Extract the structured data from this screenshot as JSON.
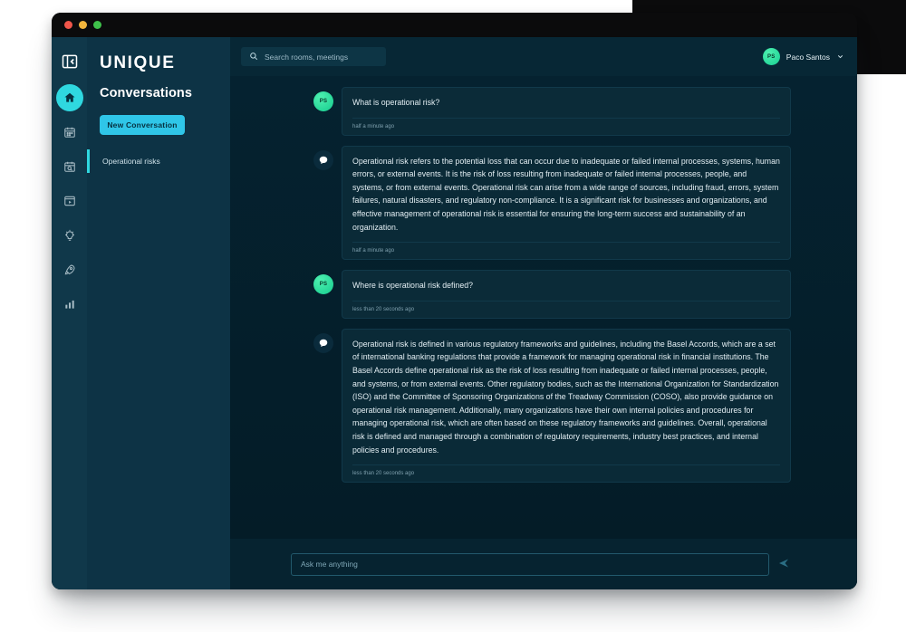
{
  "window": {
    "traffic_lights": [
      "close",
      "minimize",
      "maximize"
    ]
  },
  "rail": {
    "brand_icon": "collapse-panel-icon",
    "items": [
      {
        "name": "home",
        "icon": "home-icon",
        "active": true
      },
      {
        "name": "calendar",
        "icon": "calendar-icon",
        "active": false
      },
      {
        "name": "calendar-search",
        "icon": "calendar-search-icon",
        "active": false
      },
      {
        "name": "recordings",
        "icon": "video-window-icon",
        "active": false
      },
      {
        "name": "insights",
        "icon": "lightbulb-icon",
        "active": false
      },
      {
        "name": "launch",
        "icon": "rocket-icon",
        "active": false
      },
      {
        "name": "analytics",
        "icon": "bar-chart-icon",
        "active": false
      }
    ]
  },
  "brand": {
    "wordmark": "UNIQUE"
  },
  "panel": {
    "title": "Conversations",
    "new_conversation_label": "New Conversation",
    "conversations": [
      {
        "label": "Operational risks",
        "active": true
      }
    ]
  },
  "topbar": {
    "search": {
      "icon": "search-icon",
      "placeholder": "Search rooms, meetings",
      "value": ""
    },
    "user": {
      "initials": "PS",
      "name": "Paco Santos",
      "chevron": "chevron-down-icon"
    }
  },
  "chat": {
    "messages": [
      {
        "role": "user",
        "avatar_initials": "PS",
        "text": "What is operational risk?",
        "timestamp": "half a minute ago"
      },
      {
        "role": "bot",
        "avatar_icon": "assistant-bubble-icon",
        "text": "Operational risk refers to the potential loss that can occur due to inadequate or failed internal processes, systems, human errors, or external events. It is the risk of loss resulting from inadequate or failed internal processes, people, and systems, or from external events. Operational risk can arise from a wide range of sources, including fraud, errors, system failures, natural disasters, and regulatory non-compliance. It is a significant risk for businesses and organizations, and effective management of operational risk is essential for ensuring the long-term success and sustainability of an organization.",
        "timestamp": "half a minute ago"
      },
      {
        "role": "user",
        "avatar_initials": "PS",
        "text": "Where is operational risk defined?",
        "timestamp": "less than 20 seconds ago"
      },
      {
        "role": "bot",
        "avatar_icon": "assistant-bubble-icon",
        "text": "Operational risk is defined in various regulatory frameworks and guidelines, including the Basel Accords, which are a set of international banking regulations that provide a framework for managing operational risk in financial institutions. The Basel Accords define operational risk as the risk of loss resulting from inadequate or failed internal processes, people, and systems, or from external events. Other regulatory bodies, such as the International Organization for Standardization (ISO) and the Committee of Sponsoring Organizations of the Treadway Commission (COSO), also provide guidance on operational risk management. Additionally, many organizations have their own internal policies and procedures for managing operational risk, which are often based on these regulatory frameworks and guidelines. Overall, operational risk is defined and managed through a combination of regulatory requirements, industry best practices, and internal policies and procedures.",
        "timestamp": "less than 20 seconds ago"
      }
    ]
  },
  "composer": {
    "placeholder": "Ask me anything",
    "value": "",
    "send_icon": "send-paper-plane-icon"
  },
  "colors": {
    "accent_cyan": "#2fd8e0",
    "button_cyan": "#2fc6e8",
    "rail_bg": "#10384a",
    "panel_bg": "#0d3345",
    "chat_bg": "#041c27",
    "user_avatar_green": "#18cf92"
  }
}
